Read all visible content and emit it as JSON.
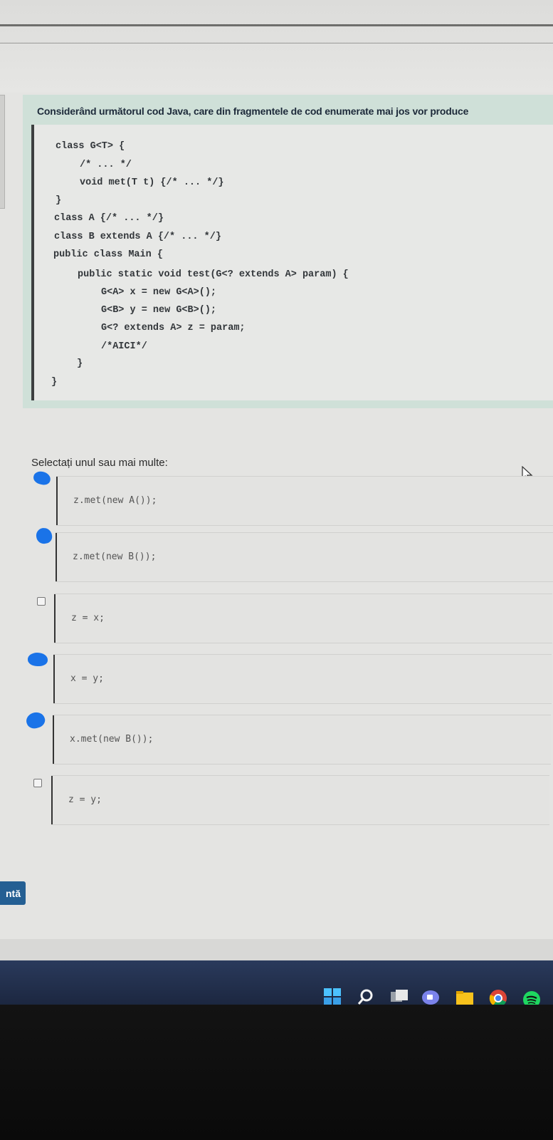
{
  "question": {
    "title": "Considerând următorul cod Java, care din fragmentele de cod enumerate mai jos vor produce",
    "code_lines": [
      "class G<T> {",
      "/* ... */",
      "void met(T t) {/* ... */}",
      "}",
      "class A {/* ... */}",
      "class B extends A {/* ... */}",
      "public class Main {",
      "public static void test(G<? extends A> param) {",
      "G<A> x = new G<A>();",
      "G<B> y = new G<B>();",
      "G<? extends A> z = param;",
      "/*AICI*/",
      "}",
      "}"
    ]
  },
  "prompt": "Selectați unul sau mai multe:",
  "options": [
    {
      "code": "z.met(new A());",
      "checked": true
    },
    {
      "code": "z.met(new B());",
      "checked": true
    },
    {
      "code": "z = x;",
      "checked": false
    },
    {
      "code": "x = y;",
      "checked": true
    },
    {
      "code": "x.met(new B());",
      "checked": true
    },
    {
      "code": "z = y;",
      "checked": false
    }
  ],
  "next_button": "ntă",
  "colors": {
    "check_mark": "#1a73e8",
    "button": "#245f93",
    "panel": "#cfe0d8"
  },
  "taskbar_icons": [
    "windows-start-icon",
    "search-icon",
    "task-view-icon",
    "teams-chat-icon",
    "file-explorer-icon",
    "chrome-icon",
    "spotify-icon"
  ]
}
